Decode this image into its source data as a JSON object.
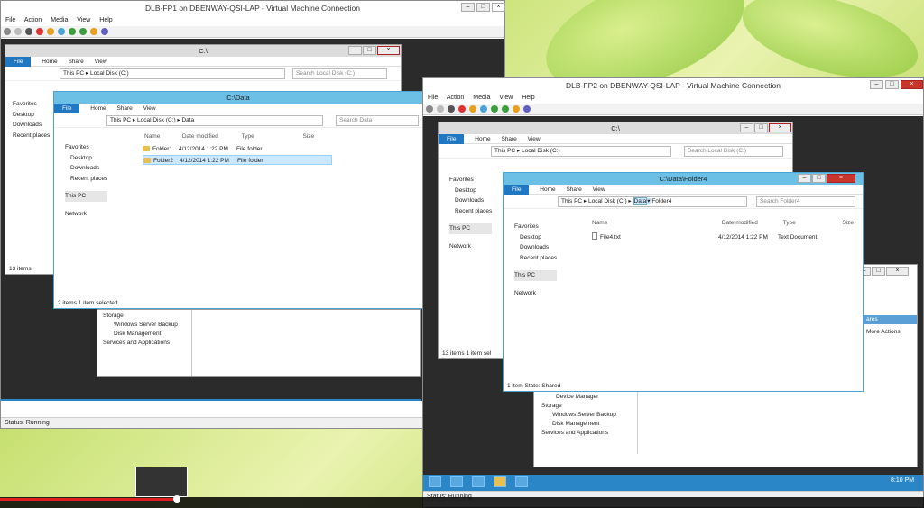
{
  "vm1": {
    "title": "DLB-FP1 on DBENWAY-QSI-LAP - Virtual Machine Connection",
    "menu": [
      "File",
      "Action",
      "Media",
      "View",
      "Help"
    ],
    "status": "Status: Running",
    "explorer_back": {
      "title": "C:\\",
      "tabs": [
        "File",
        "Home",
        "Share",
        "View"
      ],
      "path": "This PC ▸ Local Disk (C:)",
      "search": "Search Local Disk (C:)",
      "nav": [
        "Favorites",
        "Desktop",
        "Downloads",
        "Recent places",
        "This PC",
        "Network"
      ],
      "status": "13 items"
    },
    "explorer_front": {
      "title": "C:\\Data",
      "tabs": [
        "File",
        "Home",
        "Share",
        "View"
      ],
      "path": "This PC ▸ Local Disk (C:) ▸ Data",
      "search": "Search Data",
      "nav": [
        "Favorites",
        "Desktop",
        "Downloads",
        "Recent places",
        "This PC",
        "Network"
      ],
      "columns": [
        "Name",
        "Date modified",
        "Type",
        "Size"
      ],
      "rows": [
        {
          "name": "Folder1",
          "date": "4/12/2014 1:22 PM",
          "type": "File folder"
        },
        {
          "name": "Folder2",
          "date": "4/12/2014 1:22 PM",
          "type": "File folder"
        }
      ],
      "status": "2 items   1 item selected"
    },
    "mmc": {
      "items": [
        "Storage",
        "Windows Server Backup",
        "Disk Management",
        "Services and Applications"
      ]
    }
  },
  "vm2": {
    "title": "DLB-FP2 on DBENWAY-QSI-LAP - Virtual Machine Connection",
    "menu": [
      "File",
      "Action",
      "Media",
      "View",
      "Help"
    ],
    "status": "Status: Running",
    "clock": "8:10 PM",
    "explorer_back": {
      "title": "C:\\",
      "tabs": [
        "File",
        "Home",
        "Share",
        "View"
      ],
      "path": "This PC ▸ Local Disk (C:)",
      "search": "Search Local Disk (C:)",
      "nav": [
        "Favorites",
        "Desktop",
        "Downloads",
        "Recent places",
        "This PC",
        "Network"
      ],
      "status": "13 items     1 item sel"
    },
    "explorer_front": {
      "title": "C:\\Data\\Folder4",
      "tabs": [
        "File",
        "Home",
        "Share",
        "View"
      ],
      "crumbs": [
        "This PC",
        "Local Disk (C:)",
        "Data",
        "Folder4"
      ],
      "search": "Search Folder4",
      "nav": [
        "Favorites",
        "Desktop",
        "Downloads",
        "Recent places",
        "This PC",
        "Network"
      ],
      "columns": [
        "Name",
        "Date modified",
        "Type",
        "Size"
      ],
      "rows": [
        {
          "name": "File4.txt",
          "date": "4/12/2014 1:22 PM",
          "type": "Text Document"
        }
      ],
      "status": "1 item    State: Shared"
    },
    "mmc": {
      "items": [
        "Device Manager",
        "Storage",
        "Windows Server Backup",
        "Disk Management",
        "Services and Applications"
      ],
      "actions_header": "ares",
      "actions": "More Actions"
    }
  }
}
